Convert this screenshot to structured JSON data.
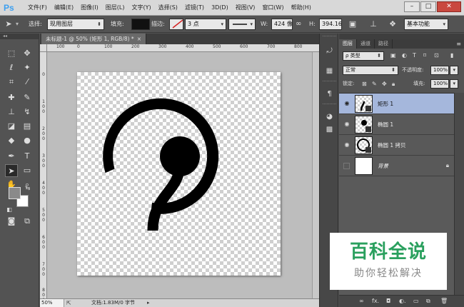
{
  "app": {
    "logo": "Ps"
  },
  "menu": [
    "文件(F)",
    "编辑(E)",
    "图像(I)",
    "图层(L)",
    "文字(Y)",
    "选择(S)",
    "滤镜(T)",
    "3D(D)",
    "视图(V)",
    "窗口(W)",
    "帮助(H)"
  ],
  "window_controls": {
    "minimize": "–",
    "maximize": "□",
    "close": "✕"
  },
  "options": {
    "select_label": "选择:",
    "select_value": "现用图层",
    "fill_label": "填充:",
    "stroke_label": "描边:",
    "stroke_size": "3 点",
    "w_label": "W:",
    "w_value": "424 像",
    "link_icon": "∞",
    "h_label": "H:",
    "h_value": "394.16",
    "workspace": "基本功能",
    "fill_color": "#111111"
  },
  "document": {
    "tab_title": "未标题-1 @ 50% (矩形 1, RGB/8) *",
    "tab_close": "×",
    "ruler_top": [
      "100",
      "0",
      "100",
      "200",
      "300",
      "400",
      "500",
      "600",
      "700",
      "800"
    ],
    "ruler_left": [
      "0",
      "1 0 0",
      "2 0 0",
      "3 0 0",
      "4 0 0",
      "5 0 0",
      "6 0 0",
      "7 0 0",
      "8 0 0"
    ],
    "zoom": "50%",
    "doc_info": "文档:1.83M/0 字节",
    "status_arrow": "▸"
  },
  "layers_panel": {
    "tabs": [
      "图层",
      "通道",
      "路径"
    ],
    "filter_kind": "ρ 类型",
    "blend_mode": "正常",
    "opacity_label": "不透明度:",
    "opacity_value": "100%",
    "lock_label": "锁定:",
    "fill_label": "填充:",
    "fill_value": "100%",
    "layers": [
      {
        "name": "矩形 1",
        "selected": true,
        "visible": true,
        "locked": false
      },
      {
        "name": "椭圆 1",
        "selected": false,
        "visible": true,
        "locked": false
      },
      {
        "name": "椭圆 1 拷贝",
        "selected": false,
        "visible": true,
        "locked": false
      },
      {
        "name": "背景",
        "selected": false,
        "visible": false,
        "locked": true
      }
    ],
    "footer_icons": [
      "link-icon",
      "fx-icon",
      "mask-icon",
      "adjustment-icon",
      "folder-icon",
      "new-layer-icon",
      "trash-icon"
    ]
  },
  "watermark": {
    "title": "百科全说",
    "subtitle": "助你轻松解决"
  }
}
